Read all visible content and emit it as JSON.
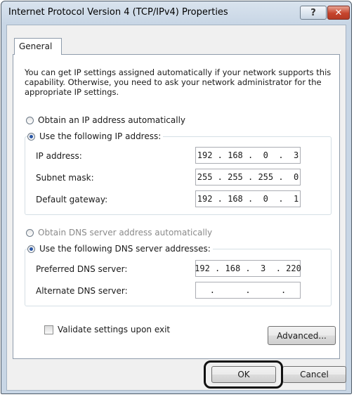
{
  "window": {
    "title": "Internet Protocol Version 4 (TCP/IPv4) Properties",
    "help_glyph": "?",
    "close_glyph": "✕"
  },
  "tabs": [
    {
      "label": "General",
      "selected": true
    }
  ],
  "description": "You can get IP settings assigned automatically if your network supports this capability. Otherwise, you need to ask your network administrator for the appropriate IP settings.",
  "ip_section": {
    "auto_label": "Obtain an IP address automatically",
    "manual_label": "Use the following IP address:",
    "selected": "manual",
    "fields": [
      {
        "label": "IP address:",
        "value": "192 . 168 .  0  .  3"
      },
      {
        "label": "Subnet mask:",
        "value": "255 . 255 . 255 .  0"
      },
      {
        "label": "Default gateway:",
        "value": "192 . 168 .  0  .  1"
      }
    ]
  },
  "dns_section": {
    "auto_label": "Obtain DNS server address automatically",
    "manual_label": "Use the following DNS server addresses:",
    "selected": "manual",
    "fields": [
      {
        "label": "Preferred DNS server:",
        "value": "192 . 168 .  3  . 220"
      },
      {
        "label": "Alternate DNS server:",
        "value": "     .      .      .     "
      }
    ]
  },
  "validate": {
    "label": "Validate settings upon exit",
    "checked": false
  },
  "buttons": {
    "advanced": "Advanced...",
    "ok": "OK",
    "cancel": "Cancel"
  }
}
